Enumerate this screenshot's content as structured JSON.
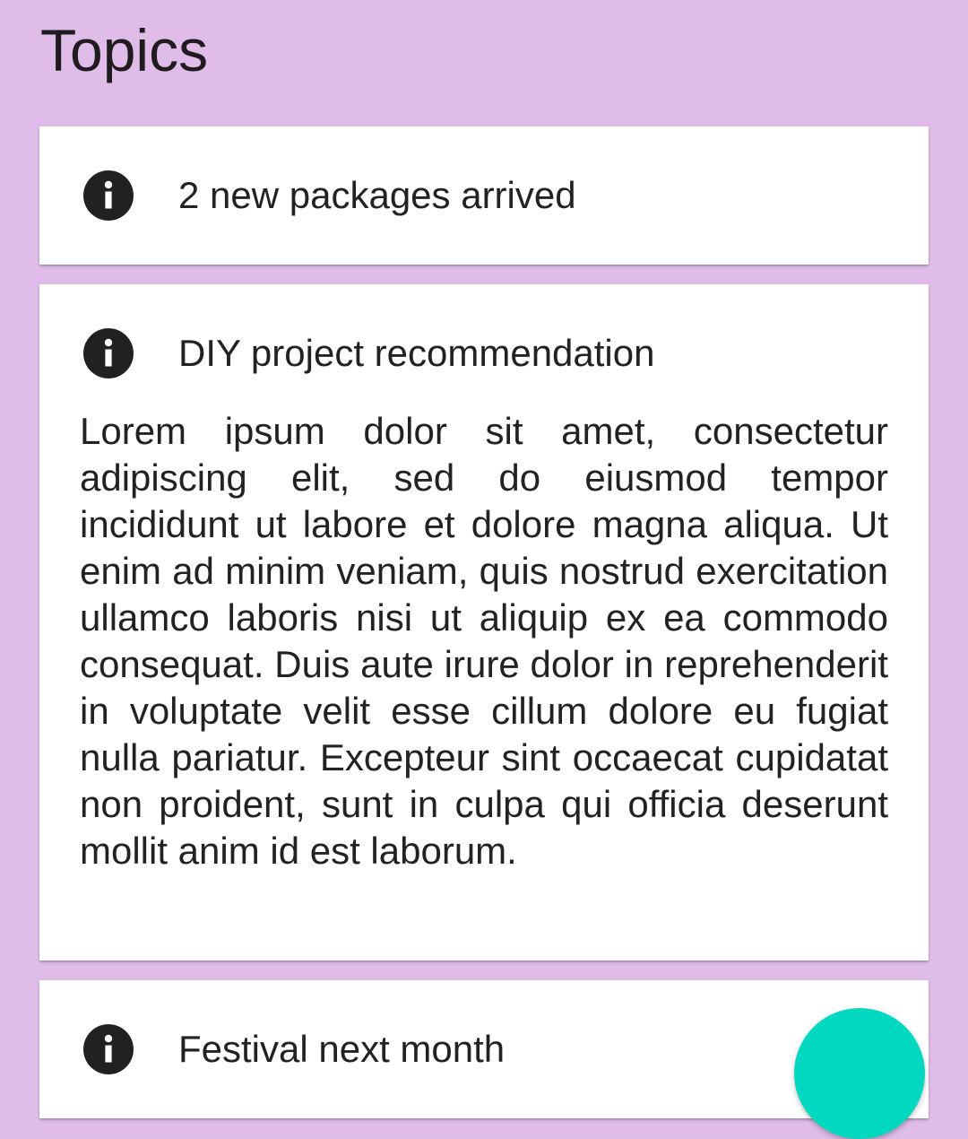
{
  "header": {
    "title": "Topics"
  },
  "cards": [
    {
      "icon": "info-icon",
      "title": "2 new packages arrived"
    },
    {
      "icon": "info-icon",
      "title": "DIY project recommendation",
      "body": "Lorem ipsum dolor sit amet, consectetur adipiscing elit, sed do eiusmod tempor incididunt ut labore et dolore magna aliqua. Ut enim ad minim veniam, quis nostrud exercitation ullamco laboris nisi ut aliquip ex ea commodo consequat. Duis aute irure dolor in reprehenderit in voluptate velit esse cillum dolore eu fugiat nulla pariatur. Excepteur sint occaecat cupidatat non proident, sunt in culpa qui officia deserunt mollit anim id est laborum."
    },
    {
      "icon": "info-icon",
      "title": "Festival next month"
    }
  ],
  "fab": {
    "icon": "add-icon"
  },
  "colors": {
    "background": "#e0bde9",
    "card": "#ffffff",
    "accent": "#00d9c0",
    "icon": "#212121"
  }
}
